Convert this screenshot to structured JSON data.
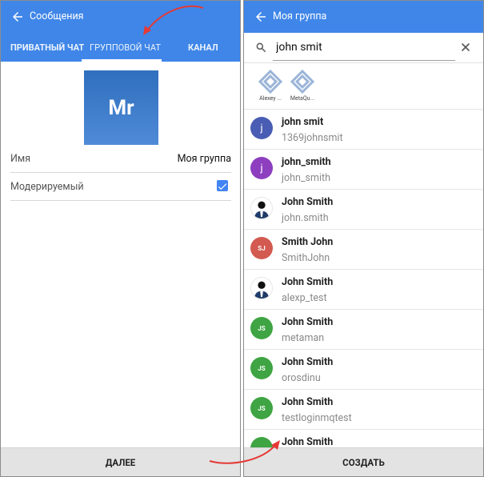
{
  "left": {
    "app_title": "Сообщения",
    "tabs": [
      "ПРИВАТНЫЙ ЧАТ",
      "ГРУППОВОЙ ЧАТ",
      "КАНАЛ"
    ],
    "avatar_text": "Mr",
    "name_label": "Имя",
    "name_value": "Моя группа",
    "moderated_label": "Модерируемый",
    "moderated_checked": true,
    "next_button": "ДАЛЕЕ"
  },
  "right": {
    "app_title": "Моя группа",
    "search_value": "john smit",
    "chips": [
      {
        "label": "Alexey ..."
      },
      {
        "label": "MetaQu..."
      }
    ],
    "contacts": [
      {
        "name": "john smit",
        "username": "1369johnsmit",
        "avatar_text": "j",
        "color": "#4a5db4"
      },
      {
        "name": "john_smith",
        "username": "john_smith",
        "avatar_text": "j",
        "color": "#8d3fc0"
      },
      {
        "name": "John Smith",
        "username": "john.smith",
        "avatar_text": "",
        "color": "#ffffff"
      },
      {
        "name": "Smith John",
        "username": "SmithJohn",
        "avatar_text": "SJ",
        "color": "#d25a50"
      },
      {
        "name": "John Smith",
        "username": "alexp_test",
        "avatar_text": "",
        "color": "#ffffff"
      },
      {
        "name": "John Smith",
        "username": "metaman",
        "avatar_text": "JS",
        "color": "#3fa443"
      },
      {
        "name": "John Smith",
        "username": "orosdinu",
        "avatar_text": "JS",
        "color": "#3fa443"
      },
      {
        "name": "John Smith",
        "username": "testloginmqtest",
        "avatar_text": "JS",
        "color": "#3fa443"
      },
      {
        "name": "John Smith",
        "username": "",
        "avatar_text": "",
        "color": "#3fa443"
      }
    ],
    "create_button": "СОЗДАТЬ"
  }
}
